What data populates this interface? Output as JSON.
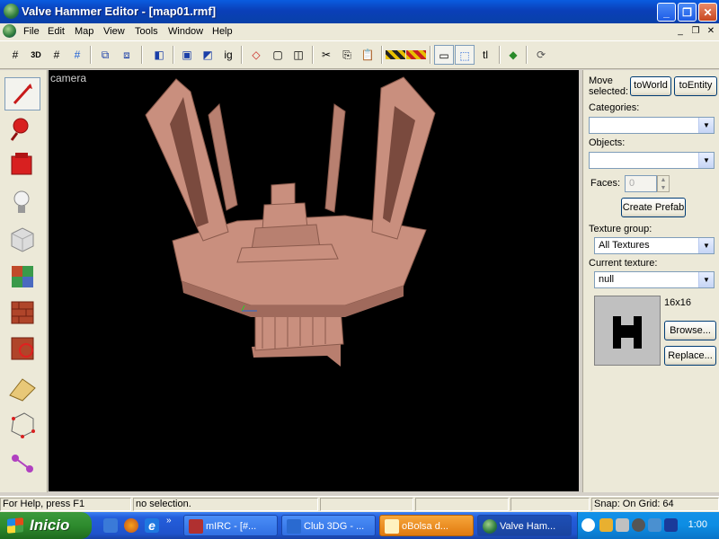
{
  "window": {
    "title": "Valve Hammer Editor - [map01.rmf]"
  },
  "menu": {
    "items": [
      "File",
      "Edit",
      "Map",
      "View",
      "Tools",
      "Window",
      "Help"
    ]
  },
  "toolbar": {
    "items": [
      "grid-icon",
      "3d-grid-icon",
      "grid-smaller-icon",
      "grid-larger-icon",
      "group-icon",
      "ungroup-icon",
      "carve-icon",
      "hollow-icon",
      "entity-icon",
      "ignore-group-icon",
      "texture-lock-icon",
      "cube-outline-icon",
      "cube-icon",
      "cut-icon",
      "copy-icon",
      "paste-icon",
      "hide-icon",
      "show-icon",
      "select-box-icon",
      "select-all-icon",
      "tl-label",
      "run-map-icon",
      "cordon-icon"
    ],
    "ig_label": "ig",
    "tl_label": "tl"
  },
  "tools": [
    "selection-tool",
    "magnify-tool",
    "camera-tool",
    "entity-tool",
    "block-tool",
    "texture-application-tool",
    "apply-current-texture-tool",
    "decal-tool",
    "clipping-tool",
    "vertex-manipulation-tool",
    "path-tool"
  ],
  "viewport": {
    "label": "camera"
  },
  "panel": {
    "move_selected_label": "Move selected:",
    "to_world_label": "toWorld",
    "to_entity_label": "toEntity",
    "categories_label": "Categories:",
    "categories_value": "",
    "objects_label": "Objects:",
    "objects_value": "",
    "faces_label": "Faces:",
    "faces_value": "0",
    "create_prefab_label": "Create Prefab",
    "texture_group_label": "Texture group:",
    "texture_group_value": "All Textures",
    "current_texture_label": "Current texture:",
    "current_texture_value": "null",
    "texture_size": "16x16",
    "browse_label": "Browse...",
    "replace_label": "Replace..."
  },
  "status": {
    "help": "For Help, press F1",
    "selection": "no selection.",
    "snap": "Snap: On Grid: 64"
  },
  "taskbar": {
    "start_label": "Inicio",
    "tasks": [
      "mIRC - [#...",
      "Club 3DG - ...",
      "oBolsa d...",
      "Valve Ham..."
    ],
    "clock": "1:00"
  },
  "colors": {
    "viewport_bg": "#000000",
    "model": "#c98f7e",
    "titlebar": "#0a3fb8"
  }
}
